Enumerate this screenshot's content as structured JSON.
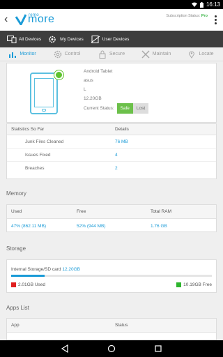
{
  "status_bar": {
    "time": "16:13"
  },
  "app_bar": {
    "back_glyph": "‹",
    "logo_remo": "remo",
    "logo_more": "more",
    "subscription_label": "Subscription Status:",
    "subscription_value": "Pro"
  },
  "device_bar": {
    "items": [
      {
        "label": "All Devices",
        "icon": "devices-icon"
      },
      {
        "label": "My Devices",
        "icon": "gear-icon"
      },
      {
        "label": "User Devices",
        "icon": "no-device-icon"
      }
    ]
  },
  "tabs": [
    {
      "label": "Monitor",
      "icon": "chart-icon",
      "active": true
    },
    {
      "label": "Control",
      "icon": "gear-icon",
      "active": false
    },
    {
      "label": "Secure",
      "icon": "lock-icon",
      "active": false
    },
    {
      "label": "Maintain",
      "icon": "wrench-icon",
      "active": false
    },
    {
      "label": "Locate",
      "icon": "pin-icon",
      "active": false
    }
  ],
  "device": {
    "name": "Android Tablet",
    "brand": "asus",
    "model": "L",
    "storage": "12.20GB",
    "status_label": "Current Status:",
    "safe_label": "Safe",
    "lost_label": "Lost"
  },
  "stats": {
    "header": [
      "Statistics So Far",
      "Details"
    ],
    "rows": [
      {
        "label": "Junk Files Cleaned",
        "value": "76 MB"
      },
      {
        "label": "Issues Fixed",
        "value": "4"
      },
      {
        "label": "Breaches",
        "value": "2"
      }
    ]
  },
  "memory": {
    "title": "Memory",
    "headers": [
      "Used",
      "Free",
      "Total RAM"
    ],
    "values": [
      "47% (862.11 MB)",
      "52% (944 MB)",
      "1.76 GB"
    ]
  },
  "storage": {
    "title": "Storage",
    "label": "Internal Storage/SD card",
    "total": "12.20GB",
    "used": "2.01GB Used",
    "free": "10.19GB Free",
    "used_fraction": 0.165,
    "used_color": "#e02020",
    "free_color": "#2db52d"
  },
  "apps": {
    "title": "Apps List",
    "headers": [
      "App",
      "Status"
    ]
  },
  "colors": {
    "accent": "#1a9bd7",
    "safe": "#6cc04a",
    "device_bar": "#3d3d3d"
  }
}
